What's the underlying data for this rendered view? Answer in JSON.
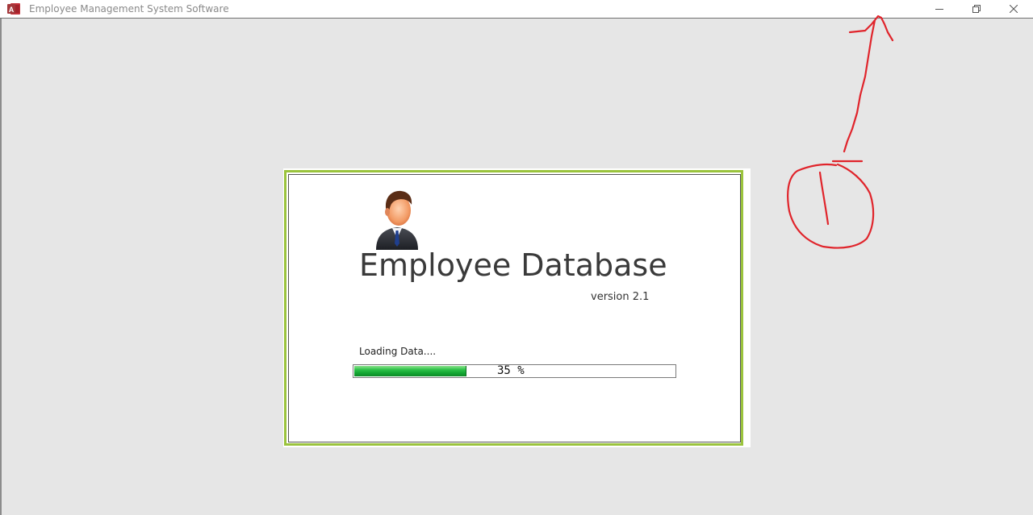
{
  "window": {
    "title": "Employee Management System Software",
    "icon": "access-app-icon",
    "controls": [
      "minimize-icon",
      "restore-icon",
      "close-icon"
    ]
  },
  "splash": {
    "title": "Employee Database",
    "version": "version 2.1",
    "loading_label": "Loading Data....",
    "progress": {
      "percent": 35,
      "label": "35 %"
    },
    "icon": "businessman-icon",
    "accent_color": "#9ac33c",
    "progress_color": "#14a834"
  },
  "annotation": {
    "color": "#e0242b",
    "marks": [
      "arrow-icon",
      "circled-number-icon"
    ]
  }
}
